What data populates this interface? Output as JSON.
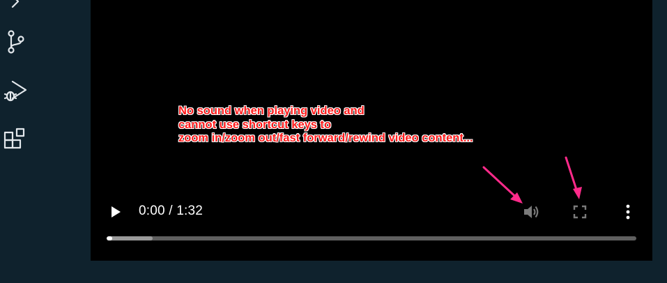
{
  "sidebar": {
    "icons": [
      "chevron-right-icon",
      "source-control-icon",
      "run-debug-icon",
      "extensions-icon"
    ]
  },
  "player": {
    "time_display": "0:00 / 1:32",
    "progress": {
      "played": 0.01,
      "buffered": 0.087
    },
    "controls": [
      "play-icon",
      "volume-icon",
      "fullscreen-icon",
      "more-options-icon"
    ]
  },
  "annotation": {
    "text": "No sound when playing video and\ncannot use shortcut keys to\nzoom in/zoom out/fast forward/rewind video content...",
    "color": "#ff1b1b",
    "arrow_color": "#ff2a8a"
  }
}
